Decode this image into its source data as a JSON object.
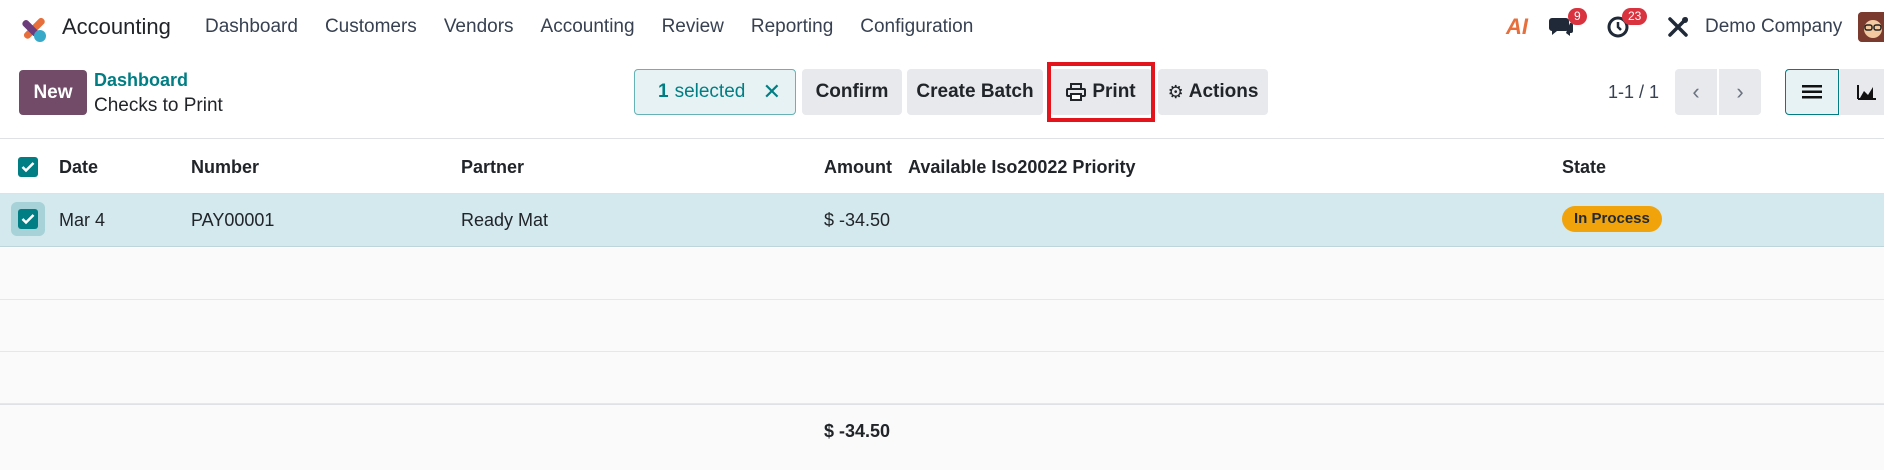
{
  "app": {
    "title": "Accounting"
  },
  "menu": [
    "Dashboard",
    "Customers",
    "Vendors",
    "Accounting",
    "Review",
    "Reporting",
    "Configuration"
  ],
  "systray": {
    "ai_label": "AI",
    "messages_badge": "9",
    "activities_badge": "23",
    "company": "Demo Company"
  },
  "control": {
    "new_label": "New",
    "breadcrumb_parent": "Dashboard",
    "breadcrumb_current": "Checks to Print",
    "selected_count": "1",
    "selected_label": "selected",
    "confirm_label": "Confirm",
    "create_batch_label": "Create Batch",
    "print_label": "Print",
    "actions_label": "Actions",
    "pager": "1-1 / 1"
  },
  "table": {
    "columns": [
      "Date",
      "Number",
      "Partner",
      "Amount",
      "Available Iso20022 Priority",
      "State"
    ],
    "rows": [
      {
        "date": "Mar 4",
        "number": "PAY00001",
        "partner": "Ready Mat",
        "amount": "$ -34.50",
        "priority": "",
        "state": "In Process"
      }
    ],
    "total": "$ -34.50"
  },
  "colors": {
    "brand": "#714b67",
    "accent": "#017e84",
    "selected_row": "#d3e9ee",
    "status_in_process": "#f0a30a",
    "highlight": "#e3141c"
  }
}
